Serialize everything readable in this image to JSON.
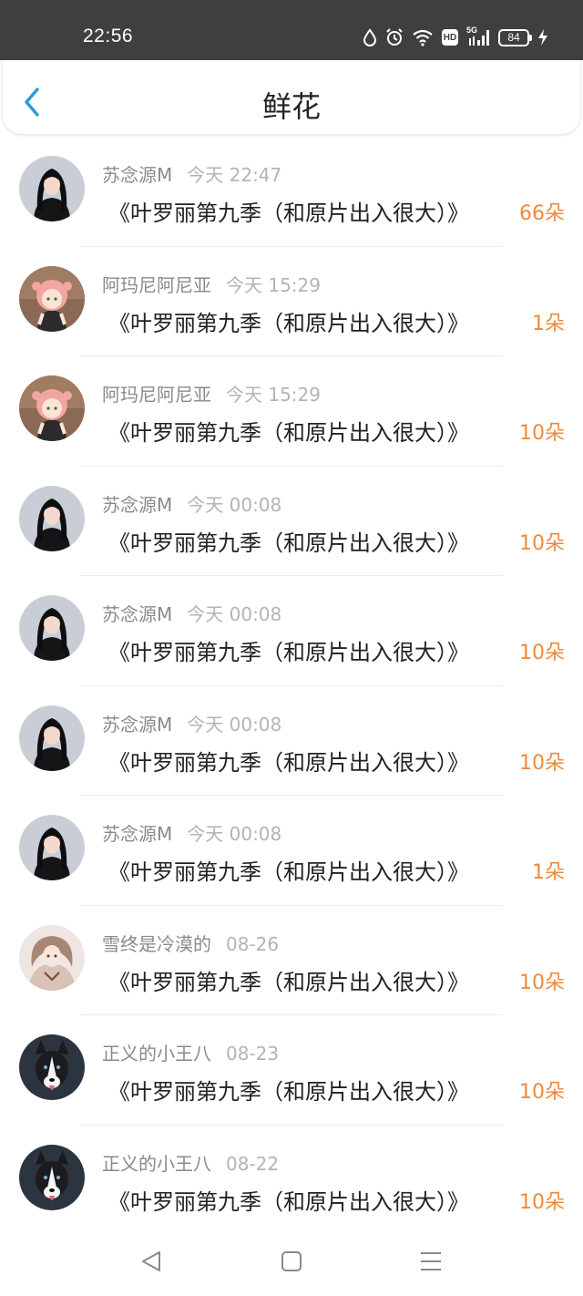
{
  "status_bar": {
    "time": "22:56",
    "network": "5G",
    "hd_label": "HD",
    "battery": "84",
    "icons": [
      "drop-icon",
      "alarm-icon",
      "wifi-icon",
      "hd-icon",
      "signal-icon",
      "battery-icon",
      "charging-icon"
    ]
  },
  "header": {
    "back_icon": "chevron-left-icon",
    "title": "鲜花",
    "accent_color": "#2a9bdc"
  },
  "count_color": "#f08a3c",
  "items": [
    {
      "avatar": "girl-dark-hair",
      "sender": "苏念源M",
      "time": "今天 22:47",
      "message": "《叶罗丽第九季（和原片出入很大）》",
      "count": "66朵"
    },
    {
      "avatar": "pink-hair-anime",
      "sender": "阿玛尼阿尼亚",
      "time": "今天 15:29",
      "message": "《叶罗丽第九季（和原片出入很大）》",
      "count": "1朵"
    },
    {
      "avatar": "pink-hair-anime",
      "sender": "阿玛尼阿尼亚",
      "time": "今天 15:29",
      "message": "《叶罗丽第九季（和原片出入很大）》",
      "count": "10朵"
    },
    {
      "avatar": "girl-dark-hair",
      "sender": "苏念源M",
      "time": "今天 00:08",
      "message": "《叶罗丽第九季（和原片出入很大）》",
      "count": "10朵"
    },
    {
      "avatar": "girl-dark-hair",
      "sender": "苏念源M",
      "time": "今天 00:08",
      "message": "《叶罗丽第九季（和原片出入很大）》",
      "count": "10朵"
    },
    {
      "avatar": "girl-dark-hair",
      "sender": "苏念源M",
      "time": "今天 00:08",
      "message": "《叶罗丽第九季（和原片出入很大）》",
      "count": "10朵"
    },
    {
      "avatar": "girl-dark-hair",
      "sender": "苏念源M",
      "time": "今天 00:08",
      "message": "《叶罗丽第九季（和原片出入很大）》",
      "count": "1朵"
    },
    {
      "avatar": "doll-girl",
      "sender": "雪终是冷漠的",
      "time": "08-26",
      "message": "《叶罗丽第九季（和原片出入很大）》",
      "count": "10朵"
    },
    {
      "avatar": "husky-dog",
      "sender": "正义的小王八",
      "time": "08-23",
      "message": "《叶罗丽第九季（和原片出入很大）》",
      "count": "10朵"
    },
    {
      "avatar": "husky-dog",
      "sender": "正义的小王八",
      "time": "08-22",
      "message": "《叶罗丽第九季（和原片出入很大）》",
      "count": "10朵"
    }
  ],
  "nav": {
    "icons": [
      "back-triangle-icon",
      "home-square-icon",
      "menu-lines-icon"
    ]
  }
}
